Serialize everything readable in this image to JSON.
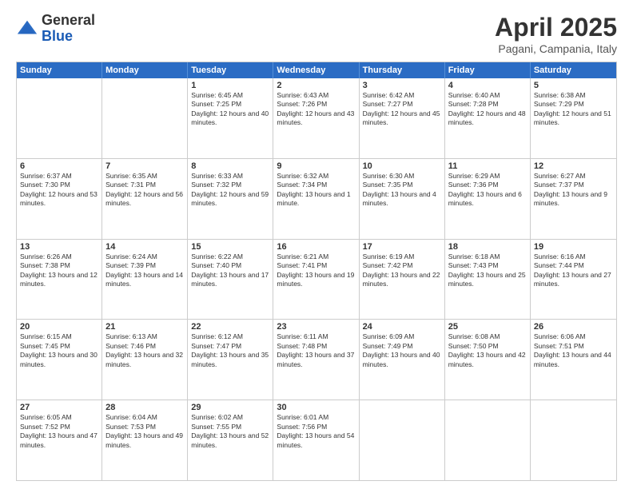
{
  "logo": {
    "general": "General",
    "blue": "Blue"
  },
  "header": {
    "month": "April 2025",
    "location": "Pagani, Campania, Italy"
  },
  "weekdays": [
    "Sunday",
    "Monday",
    "Tuesday",
    "Wednesday",
    "Thursday",
    "Friday",
    "Saturday"
  ],
  "rows": [
    [
      {
        "day": "",
        "info": ""
      },
      {
        "day": "",
        "info": ""
      },
      {
        "day": "1",
        "info": "Sunrise: 6:45 AM\nSunset: 7:25 PM\nDaylight: 12 hours and 40 minutes."
      },
      {
        "day": "2",
        "info": "Sunrise: 6:43 AM\nSunset: 7:26 PM\nDaylight: 12 hours and 43 minutes."
      },
      {
        "day": "3",
        "info": "Sunrise: 6:42 AM\nSunset: 7:27 PM\nDaylight: 12 hours and 45 minutes."
      },
      {
        "day": "4",
        "info": "Sunrise: 6:40 AM\nSunset: 7:28 PM\nDaylight: 12 hours and 48 minutes."
      },
      {
        "day": "5",
        "info": "Sunrise: 6:38 AM\nSunset: 7:29 PM\nDaylight: 12 hours and 51 minutes."
      }
    ],
    [
      {
        "day": "6",
        "info": "Sunrise: 6:37 AM\nSunset: 7:30 PM\nDaylight: 12 hours and 53 minutes."
      },
      {
        "day": "7",
        "info": "Sunrise: 6:35 AM\nSunset: 7:31 PM\nDaylight: 12 hours and 56 minutes."
      },
      {
        "day": "8",
        "info": "Sunrise: 6:33 AM\nSunset: 7:32 PM\nDaylight: 12 hours and 59 minutes."
      },
      {
        "day": "9",
        "info": "Sunrise: 6:32 AM\nSunset: 7:34 PM\nDaylight: 13 hours and 1 minute."
      },
      {
        "day": "10",
        "info": "Sunrise: 6:30 AM\nSunset: 7:35 PM\nDaylight: 13 hours and 4 minutes."
      },
      {
        "day": "11",
        "info": "Sunrise: 6:29 AM\nSunset: 7:36 PM\nDaylight: 13 hours and 6 minutes."
      },
      {
        "day": "12",
        "info": "Sunrise: 6:27 AM\nSunset: 7:37 PM\nDaylight: 13 hours and 9 minutes."
      }
    ],
    [
      {
        "day": "13",
        "info": "Sunrise: 6:26 AM\nSunset: 7:38 PM\nDaylight: 13 hours and 12 minutes."
      },
      {
        "day": "14",
        "info": "Sunrise: 6:24 AM\nSunset: 7:39 PM\nDaylight: 13 hours and 14 minutes."
      },
      {
        "day": "15",
        "info": "Sunrise: 6:22 AM\nSunset: 7:40 PM\nDaylight: 13 hours and 17 minutes."
      },
      {
        "day": "16",
        "info": "Sunrise: 6:21 AM\nSunset: 7:41 PM\nDaylight: 13 hours and 19 minutes."
      },
      {
        "day": "17",
        "info": "Sunrise: 6:19 AM\nSunset: 7:42 PM\nDaylight: 13 hours and 22 minutes."
      },
      {
        "day": "18",
        "info": "Sunrise: 6:18 AM\nSunset: 7:43 PM\nDaylight: 13 hours and 25 minutes."
      },
      {
        "day": "19",
        "info": "Sunrise: 6:16 AM\nSunset: 7:44 PM\nDaylight: 13 hours and 27 minutes."
      }
    ],
    [
      {
        "day": "20",
        "info": "Sunrise: 6:15 AM\nSunset: 7:45 PM\nDaylight: 13 hours and 30 minutes."
      },
      {
        "day": "21",
        "info": "Sunrise: 6:13 AM\nSunset: 7:46 PM\nDaylight: 13 hours and 32 minutes."
      },
      {
        "day": "22",
        "info": "Sunrise: 6:12 AM\nSunset: 7:47 PM\nDaylight: 13 hours and 35 minutes."
      },
      {
        "day": "23",
        "info": "Sunrise: 6:11 AM\nSunset: 7:48 PM\nDaylight: 13 hours and 37 minutes."
      },
      {
        "day": "24",
        "info": "Sunrise: 6:09 AM\nSunset: 7:49 PM\nDaylight: 13 hours and 40 minutes."
      },
      {
        "day": "25",
        "info": "Sunrise: 6:08 AM\nSunset: 7:50 PM\nDaylight: 13 hours and 42 minutes."
      },
      {
        "day": "26",
        "info": "Sunrise: 6:06 AM\nSunset: 7:51 PM\nDaylight: 13 hours and 44 minutes."
      }
    ],
    [
      {
        "day": "27",
        "info": "Sunrise: 6:05 AM\nSunset: 7:52 PM\nDaylight: 13 hours and 47 minutes."
      },
      {
        "day": "28",
        "info": "Sunrise: 6:04 AM\nSunset: 7:53 PM\nDaylight: 13 hours and 49 minutes."
      },
      {
        "day": "29",
        "info": "Sunrise: 6:02 AM\nSunset: 7:55 PM\nDaylight: 13 hours and 52 minutes."
      },
      {
        "day": "30",
        "info": "Sunrise: 6:01 AM\nSunset: 7:56 PM\nDaylight: 13 hours and 54 minutes."
      },
      {
        "day": "",
        "info": ""
      },
      {
        "day": "",
        "info": ""
      },
      {
        "day": "",
        "info": ""
      }
    ]
  ]
}
